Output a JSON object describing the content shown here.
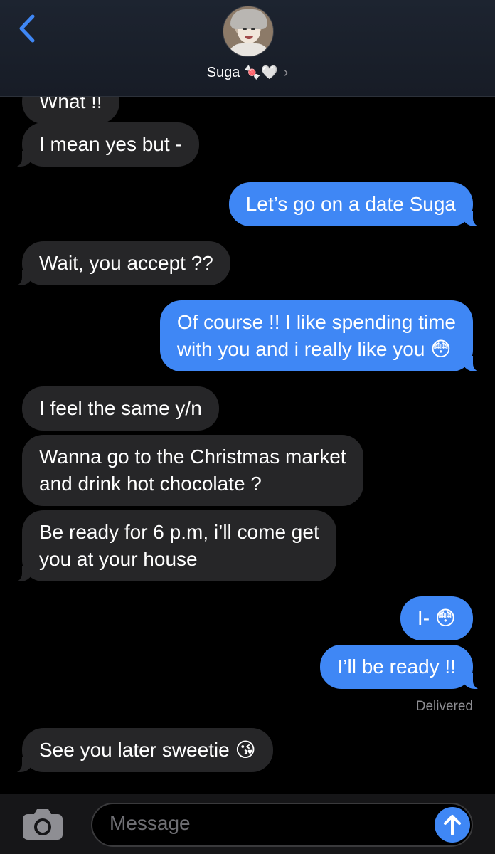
{
  "header": {
    "contact_name": "Suga",
    "contact_emoji": "🍬🤍",
    "back_icon": "chevron-left-icon",
    "chevron": "›"
  },
  "messages": [
    {
      "sender": "contact",
      "text": "What !!"
    },
    {
      "sender": "contact",
      "text": "I mean yes but -"
    },
    {
      "sender": "me",
      "text": "Let’s go on a date Suga"
    },
    {
      "sender": "contact",
      "text": "Wait, you accept ??"
    },
    {
      "sender": "me",
      "lines": [
        "Of course !! I like spending time",
        "with you and i really like you 😳"
      ]
    },
    {
      "sender": "contact",
      "text": "I feel the same y/n"
    },
    {
      "sender": "contact",
      "lines": [
        "Wanna go to the Christmas market",
        "and drink hot chocolate ?"
      ]
    },
    {
      "sender": "contact",
      "lines": [
        "Be ready for 6 p.m, i’ll come get",
        "you at your house"
      ]
    },
    {
      "sender": "me",
      "text": "I- 😳"
    },
    {
      "sender": "me",
      "text": "I’ll be ready !!"
    },
    {
      "sender": "contact",
      "text": "See you later sweetie 😘"
    }
  ],
  "status": {
    "delivered": "Delivered"
  },
  "composer": {
    "placeholder": "Message",
    "camera_icon": "camera-icon",
    "send_icon": "arrow-up-icon"
  },
  "colors": {
    "incoming_bubble": "#262628",
    "outgoing_bubble": "#3f87f5",
    "background": "#000000",
    "accent": "#3f87f5"
  }
}
